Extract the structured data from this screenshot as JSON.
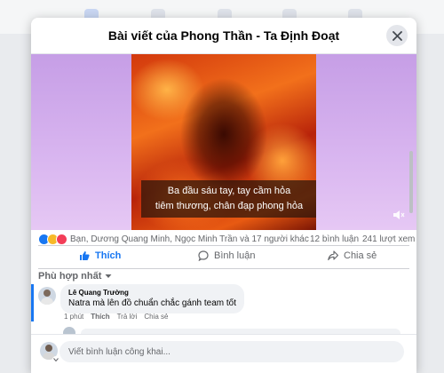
{
  "modal": {
    "title": "Bài viết của Phong Thần - Ta Định Đoạt"
  },
  "video": {
    "subtitle_line1": "Ba đầu sáu tay, tay cầm hỏa",
    "subtitle_line2": "tiêm thương, chân đạp phong hỏa"
  },
  "stats": {
    "reactions": [
      "like",
      "haha",
      "love"
    ],
    "reaction_colors": {
      "like": "#1877f2",
      "haha": "#f7b928",
      "love": "#f33e58"
    },
    "names": "Bạn, Dương Quang Minh, Ngọc Minh Trần và 17 người khác",
    "comments": "12 bình luận",
    "views": "241 lượt xem"
  },
  "actions": {
    "like": "Thích",
    "comment": "Bình luận",
    "share": "Chia sẻ"
  },
  "sort": {
    "label": "Phù hợp nhất"
  },
  "comments": [
    {
      "author": "Lê Quang Trường",
      "text": "Natra mà lên đồ chuẩn chắc gánh team tốt",
      "time": "1 phút",
      "like": "Thích",
      "reply": "Trả lời",
      "share": "Chia sẻ"
    }
  ],
  "composer": {
    "placeholder": "Viết bình luận công khai..."
  },
  "colors": {
    "accent": "#1877f2",
    "modal_bg": "#ffffff",
    "media_bg": "#d9b6f0"
  }
}
